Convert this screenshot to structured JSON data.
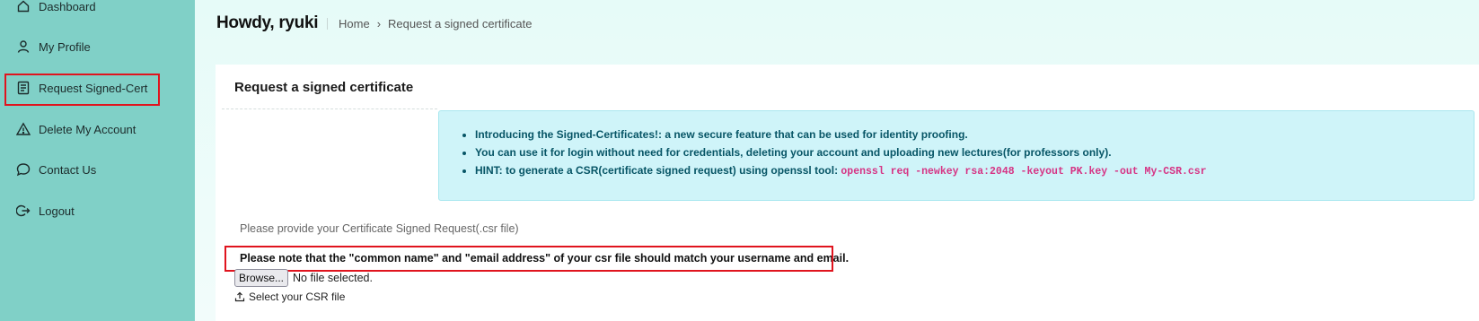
{
  "sidebar": {
    "items": [
      {
        "label": "Dashboard",
        "icon": "home-icon"
      },
      {
        "label": "My Profile",
        "icon": "user-icon"
      },
      {
        "label": "Request Signed-Cert",
        "icon": "document-icon",
        "highlighted": true
      },
      {
        "label": "Delete My Account",
        "icon": "warning-icon"
      },
      {
        "label": "Contact Us",
        "icon": "chat-bubble-icon"
      },
      {
        "label": "Logout",
        "icon": "logout-icon"
      }
    ]
  },
  "header": {
    "greeting": "Howdy, ryuki",
    "breadcrumb": {
      "home": "Home",
      "separator": "›",
      "current": "Request a signed certificate"
    }
  },
  "card": {
    "title": "Request a signed certificate",
    "info": {
      "item1": "Introducing the Signed-Certificates!: a new secure feature that can be used for identity proofing.",
      "item2": "You can use it for login without need for credentials, deleting your account and uploading new lectures(for professors only).",
      "item3_prefix": "HINT: to generate a CSR(certificate signed request) using openssl tool: ",
      "item3_code": "openssl req -newkey rsa:2048 -keyout PK.key -out My-CSR.csr"
    },
    "provide_text": "Please provide your Certificate Signed Request(.csr file)",
    "note_text": "Please note that the \"common name\" and \"email address\" of your csr file should match your username and email.",
    "browse_label": "Browse...",
    "file_status": "No file selected.",
    "select_label": "Select your CSR file"
  },
  "colors": {
    "sidebar_bg": "#80d0c7",
    "highlight": "#e0141e",
    "info_bg": "#cff4f9",
    "code": "#d63384"
  }
}
